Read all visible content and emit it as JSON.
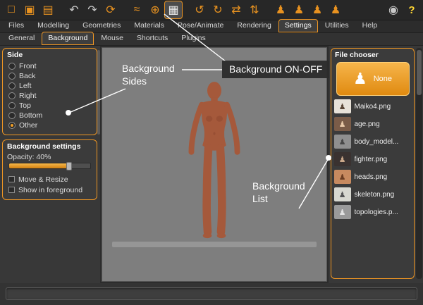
{
  "toolbar": {
    "icons": [
      {
        "name": "new",
        "glyph": "□"
      },
      {
        "name": "save",
        "glyph": "▣"
      },
      {
        "name": "load",
        "glyph": "▤"
      },
      {
        "name": "undo",
        "glyph": "↶"
      },
      {
        "name": "redo",
        "glyph": "↷"
      },
      {
        "name": "reset",
        "glyph": "⟳"
      },
      {
        "name": "modifiers",
        "glyph": "≈"
      },
      {
        "name": "globe",
        "glyph": "⊕"
      },
      {
        "name": "background-toggle",
        "glyph": "▦",
        "active": true
      },
      {
        "name": "rotate-left",
        "glyph": "↺"
      },
      {
        "name": "rotate-right",
        "glyph": "↻"
      },
      {
        "name": "rotate-horizontal",
        "glyph": "⇄"
      },
      {
        "name": "rotate-vertical",
        "glyph": "⇅"
      },
      {
        "name": "view-front",
        "glyph": "♟"
      },
      {
        "name": "view-side",
        "glyph": "♟"
      },
      {
        "name": "view-top",
        "glyph": "♟"
      },
      {
        "name": "pose",
        "glyph": "♟"
      },
      {
        "name": "grab-screen",
        "glyph": "◉"
      },
      {
        "name": "help",
        "glyph": "?"
      }
    ]
  },
  "menu_tabs": {
    "items": [
      "Files",
      "Modelling",
      "Geometries",
      "Materials",
      "Pose/Animate",
      "Rendering",
      "Settings",
      "Utilities",
      "Help"
    ],
    "active": "Settings"
  },
  "sub_tabs": {
    "items": [
      "General",
      "Background",
      "Mouse",
      "Shortcuts",
      "Plugins"
    ],
    "active": "Background"
  },
  "side_group": {
    "title": "Side",
    "options": [
      "Front",
      "Back",
      "Left",
      "Right",
      "Top",
      "Bottom",
      "Other"
    ],
    "selected": "Other"
  },
  "background_settings": {
    "title": "Background settings",
    "opacity_label": "Opacity: 40%",
    "opacity_value": 40,
    "checkboxes": [
      "Move & Resize",
      "Show in foreground"
    ]
  },
  "file_chooser": {
    "title": "File chooser",
    "selected": "None",
    "none_label": "None",
    "none_glyph": "♟",
    "thumb_glyph": "♟",
    "items": [
      "Maiko4.png",
      "age.png",
      "body_model...",
      "fighter.png",
      "heads.png",
      "skeleton.png",
      "topologies.p..."
    ]
  },
  "annotations": {
    "sides": "Background Sides",
    "onoff": "Background ON-OFF",
    "list": "Background List"
  },
  "colors": {
    "accent": "#ef9623",
    "panel_bg": "#3a3a3a",
    "viewport_bg": "#7e7e7e",
    "skin": "#a5593b"
  }
}
